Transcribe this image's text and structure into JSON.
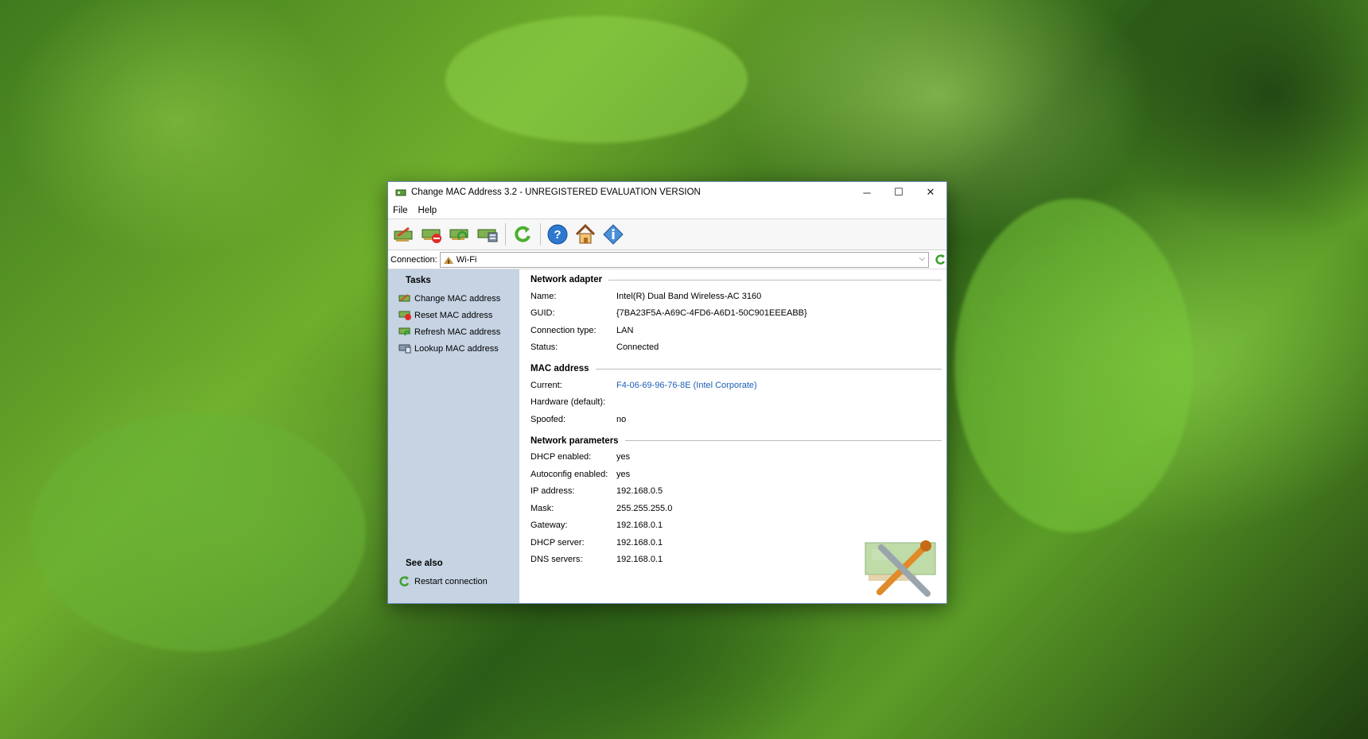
{
  "window": {
    "title": "Change MAC Address 3.2 - UNREGISTERED EVALUATION VERSION",
    "controls": {
      "minimize": "─",
      "maximize": "☐",
      "close": "✕"
    }
  },
  "menu": {
    "items": [
      "File",
      "Help"
    ]
  },
  "toolbar": {
    "icons": [
      "change-mac-icon",
      "reset-mac-icon",
      "refresh-mac-icon",
      "lookup-mac-icon",
      "restart-connection-icon",
      "help-icon",
      "home-icon",
      "about-icon"
    ]
  },
  "connection": {
    "label": "Connection:",
    "value": "Wi-Fi"
  },
  "tasks": {
    "title": "Tasks",
    "items": [
      "Change MAC address",
      "Reset MAC address",
      "Refresh MAC address",
      "Lookup MAC address"
    ]
  },
  "see_also": {
    "title": "See also",
    "items": [
      "Restart connection"
    ]
  },
  "sections": {
    "adapter": {
      "title": "Network adapter",
      "rows": [
        {
          "k": "Name:",
          "v": "Intel(R) Dual Band Wireless-AC 3160"
        },
        {
          "k": "GUID:",
          "v": "{7BA23F5A-A69C-4FD6-A6D1-50C901EEEABB}"
        },
        {
          "k": "Connection type:",
          "v": "LAN"
        },
        {
          "k": "Status:",
          "v": "Connected"
        }
      ]
    },
    "mac": {
      "title": "MAC address",
      "rows": [
        {
          "k": "Current:",
          "v": "F4-06-69-96-76-8E (Intel Corporate)"
        },
        {
          "k": "Hardware (default):",
          "v": ""
        },
        {
          "k": "Spoofed:",
          "v": "no"
        }
      ]
    },
    "params": {
      "title": "Network parameters",
      "rows": [
        {
          "k": "DHCP enabled:",
          "v": "yes"
        },
        {
          "k": "Autoconfig enabled:",
          "v": "yes"
        },
        {
          "k": "IP address:",
          "v": "192.168.0.5"
        },
        {
          "k": "Mask:",
          "v": "255.255.255.0"
        },
        {
          "k": "Gateway:",
          "v": "192.168.0.1"
        },
        {
          "k": "DHCP server:",
          "v": "192.168.0.1"
        },
        {
          "k": "DNS servers:",
          "v": "192.168.0.1"
        }
      ]
    }
  },
  "colors": {
    "link": "#1d5fb6",
    "taskpane": "#c5d3e3",
    "accent_green": "#3c9a2e"
  }
}
